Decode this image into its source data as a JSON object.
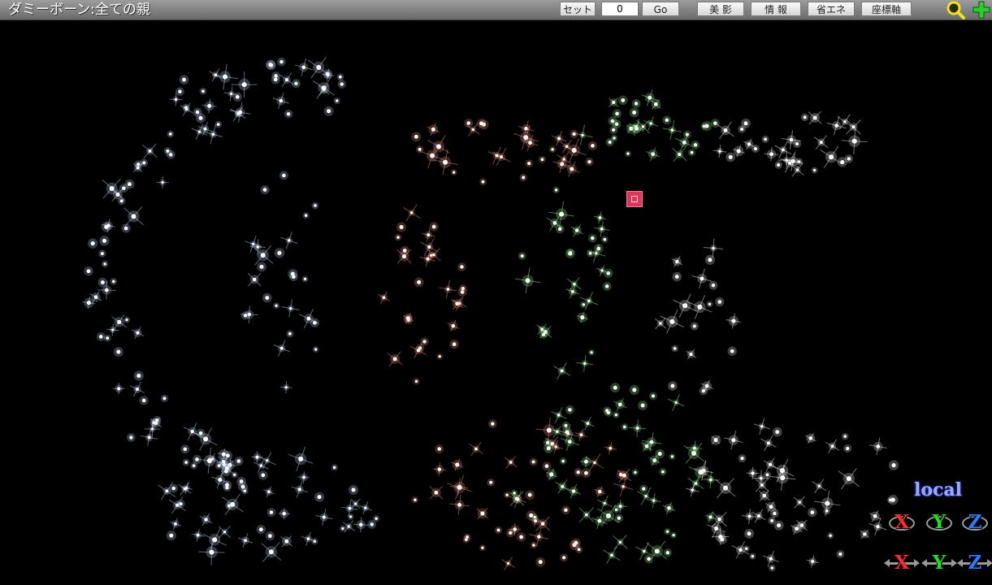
{
  "window": {
    "title": "ダミーボーン:全ての親"
  },
  "toolbar": {
    "set_label": "セット",
    "frame_value": "0",
    "go_label": "Go",
    "beauty_shadow_label": "美 影",
    "info_label": "情 報",
    "eco_label": "省エネ",
    "axis_label": "座標軸"
  },
  "icons": {
    "zoom": "magnifier-icon",
    "move": "move-cross-icon"
  },
  "viewport": {
    "mode_label": "local",
    "rotate_axes": [
      "X",
      "Y",
      "Z"
    ],
    "move_axes": [
      "X",
      "Y",
      "Z"
    ]
  },
  "colors": {
    "x_axis": "#ff2a2a",
    "y_axis": "#22dd22",
    "z_axis": "#2a7cff",
    "selected_marker": "#d8375a",
    "particle_blue": "#cfe0ff",
    "particle_red": "#ff9a86",
    "particle_green": "#9cff9c",
    "particle_mixed": "#ffffff"
  }
}
